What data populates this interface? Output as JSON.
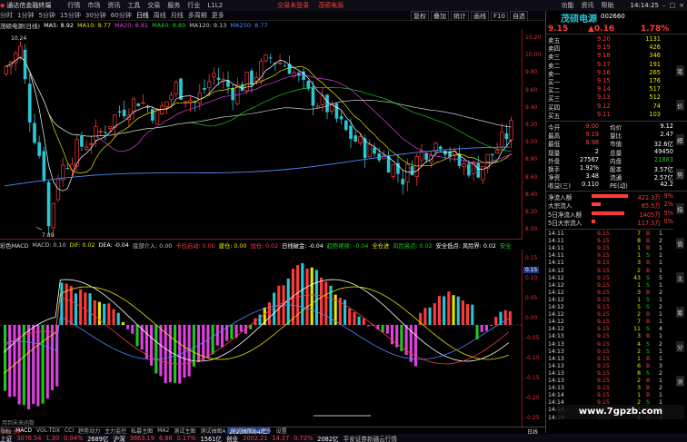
{
  "app": {
    "title": "通达信金融终端",
    "menus": [
      "行情",
      "市场",
      "资讯",
      "工具",
      "交易",
      "服务",
      "行业",
      "L1L2"
    ],
    "trade_login": "交易未登录",
    "stock_name_tab": "茂硕电源",
    "right_menus": [
      "功能",
      "资讯",
      "帮助"
    ],
    "clock": "14:14:25"
  },
  "toolbar": {
    "periods": [
      "分时",
      "1分钟",
      "5分钟",
      "15分钟",
      "30分钟",
      "60分钟",
      "日线",
      "周线",
      "月线",
      "多周期",
      "更多"
    ],
    "tools": [
      "复权",
      "叠加",
      "统计",
      "画线",
      "F10",
      "自选"
    ]
  },
  "chart": {
    "title": "茂硕电源(日线)",
    "ma": [
      {
        "label": "MA5: 8.92",
        "color": "#ffffff"
      },
      {
        "label": "MA10: 8.77",
        "color": "#e6e600"
      },
      {
        "label": "MA20: 8.81",
        "color": "#e13fe1"
      },
      {
        "label": "MA60: 8.89",
        "color": "#1ec81e"
      },
      {
        "label": "MA120: 9.13",
        "color": "#cccccc"
      },
      {
        "label": "MA250: 8.77",
        "color": "#4c8cff"
      }
    ],
    "high_label": "10.24",
    "low_label": "7.89",
    "yticks": [
      "10.20",
      "10.00",
      "9.80",
      "9.60",
      "9.40",
      "9.20",
      "9.00",
      "8.80",
      "8.60",
      "8.40",
      "8.20",
      "8.00"
    ]
  },
  "indicator": {
    "title": "彩色MACD",
    "items": [
      {
        "t": "MACD: 0.10",
        "c": "#c0c0c0"
      },
      {
        "t": "DIF: 0.02",
        "c": "#e6e600"
      },
      {
        "t": "DEA: -0.04",
        "c": "#ffffff"
      },
      {
        "t": "底部介入: 0.00",
        "c": "#c0c0c0"
      },
      {
        "t": "卡位启动: 0.00",
        "c": "#ff3b3b"
      },
      {
        "t": "建仓: 0.00",
        "c": "#e6e600"
      },
      {
        "t": "加仓: 0.02",
        "c": "#ff3b3b"
      },
      {
        "t": "日线破金: -0.04",
        "c": "#ffffff"
      },
      {
        "t": "趋势继续: -0.04",
        "c": "#1ec81e"
      },
      {
        "t": "全仓进",
        "c": "#e6e600"
      },
      {
        "t": "风险高点: 0.02",
        "c": "#1ec81e"
      },
      {
        "t": "安全低点: 风险界: 0.02",
        "c": "#ffffff"
      },
      {
        "t": "安全",
        "c": "#1ec81e"
      }
    ],
    "yticks": [
      "0.15",
      "0.10",
      "0.05",
      "0.00",
      "-0.05",
      "-0.10",
      "-0.15",
      "-0.20",
      "-0.25"
    ],
    "marker": "0.15",
    "note": "用到未来函数"
  },
  "axis": {
    "year": "2023年",
    "cursor_date": "2023/07/04/二",
    "right_label": "日线"
  },
  "bottom_tabs": [
    "指标",
    "MACD",
    "VOL-TDX",
    "CCI",
    "趋势动力",
    "主力监控",
    "私募主图",
    "MA2",
    "测试主图",
    "测试抽图A",
    "测试抽图B",
    "更多",
    "设置"
  ],
  "bottom_tabs2": [
    "扩展↑",
    "关联报价",
    "资金分布",
    "综合资讯",
    "行业资讯",
    "互动问答",
    "普及版功能说明"
  ],
  "quote": {
    "name": "茂硕电源",
    "code": "002660",
    "price": "9.15",
    "change": "▲0.16",
    "pct": "1.78%",
    "asks": [
      {
        "l": "卖五",
        "p": "9.20",
        "v": "1131"
      },
      {
        "l": "卖四",
        "p": "9.19",
        "v": "426"
      },
      {
        "l": "卖三",
        "p": "9.18",
        "v": "346"
      },
      {
        "l": "卖二",
        "p": "9.17",
        "v": "191"
      },
      {
        "l": "卖一",
        "p": "9.16",
        "v": "265"
      }
    ],
    "bids": [
      {
        "l": "买一",
        "p": "9.15",
        "v": "176"
      },
      {
        "l": "买二",
        "p": "9.14",
        "v": "517"
      },
      {
        "l": "买三",
        "p": "9.13",
        "v": "512"
      },
      {
        "l": "买四",
        "p": "9.12",
        "v": "74"
      },
      {
        "l": "买五",
        "p": "9.11",
        "v": "103"
      }
    ],
    "stats": [
      {
        "a": "今开",
        "av": "9.00",
        "b": "均价",
        "bv": "9.12"
      },
      {
        "a": "最高",
        "av": "9.19",
        "b": "量比",
        "bv": "2.47"
      },
      {
        "a": "最低",
        "av": "8.98",
        "b": "市值",
        "bv": "32.6亿"
      },
      {
        "a": "现量",
        "av": "2",
        "b": "总量",
        "bv": "49450"
      },
      {
        "a": "外盘",
        "av": "27567",
        "b": "内盘",
        "bv": "21883"
      },
      {
        "a": "换手",
        "av": "1.92%",
        "b": "股本",
        "bv": "3.57亿"
      },
      {
        "a": "净资",
        "av": "3.48",
        "b": "流通",
        "bv": "2.57亿"
      },
      {
        "a": "收益(三)",
        "av": "0.110",
        "b": "PE(动)",
        "bv": "42.2"
      }
    ],
    "flows": [
      {
        "l": "净流入额",
        "v": "421.3万",
        "p": "9%"
      },
      {
        "l": "大宗流入",
        "v": "85.5万",
        "p": "2%"
      },
      {
        "l": "5日净流入额",
        "v": "1405万",
        "p": "5%"
      },
      {
        "l": "5日大宗流入",
        "v": "117.3万",
        "p": "0%"
      }
    ],
    "ticks": [
      {
        "t": "14:11",
        "p": "9.15",
        "v": "7",
        "d": "B",
        "n": "1"
      },
      {
        "t": "14:11",
        "p": "9.15",
        "v": "8",
        "d": "B",
        "n": "2"
      },
      {
        "t": "14:11",
        "p": "9.15",
        "v": "1",
        "d": "B",
        "n": "1"
      },
      {
        "t": "14:11",
        "p": "9.15",
        "v": "1",
        "d": "S",
        "n": "1"
      },
      {
        "t": "14:11",
        "p": "9.15",
        "v": "3",
        "d": "B",
        "n": "1"
      },
      {
        "t": "14:12",
        "p": "9.15",
        "v": "2",
        "d": "B",
        "n": "1"
      },
      {
        "t": "14:12",
        "p": "9.15",
        "v": "43",
        "d": "S",
        "n": "5"
      },
      {
        "t": "14:12",
        "p": "9.15",
        "v": "1",
        "d": "S",
        "n": "1"
      },
      {
        "t": "14:12",
        "p": "9.15",
        "v": "3",
        "d": "B",
        "n": "2"
      },
      {
        "t": "14:12",
        "p": "9.15",
        "v": "1",
        "d": "S",
        "n": "1"
      },
      {
        "t": "14:12",
        "p": "9.15",
        "v": "5",
        "d": "S",
        "n": "2"
      },
      {
        "t": "14:12",
        "p": "9.15",
        "v": "2",
        "d": "B",
        "n": "1"
      },
      {
        "t": "14:12",
        "p": "9.15",
        "v": "7",
        "d": "B",
        "n": "1"
      },
      {
        "t": "14:12",
        "p": "9.15",
        "v": "11",
        "d": "S",
        "n": "4"
      },
      {
        "t": "14:13",
        "p": "9.15",
        "v": "3",
        "d": "B",
        "n": "1"
      },
      {
        "t": "14:13",
        "p": "9.15",
        "v": "4",
        "d": "S",
        "n": "2"
      },
      {
        "t": "14:13",
        "p": "9.15",
        "v": "2",
        "d": "S",
        "n": "1"
      },
      {
        "t": "14:13",
        "p": "9.15",
        "v": "1",
        "d": "B",
        "n": "1"
      },
      {
        "t": "14:13",
        "p": "9.15",
        "v": "6",
        "d": "B",
        "n": "3"
      },
      {
        "t": "14:13",
        "p": "9.15",
        "v": "8",
        "d": "S",
        "n": "2"
      },
      {
        "t": "14:13",
        "p": "9.15",
        "v": "2",
        "d": "B",
        "n": "1"
      },
      {
        "t": "14:13",
        "p": "9.15",
        "v": "3",
        "d": "B",
        "n": "2"
      },
      {
        "t": "14:14",
        "p": "9.15",
        "v": "1",
        "d": "B",
        "n": "1"
      },
      {
        "t": "14:14",
        "p": "9.15",
        "v": "2",
        "d": "S",
        "n": "1"
      },
      {
        "t": "14:14",
        "p": "9.15",
        "v": "4",
        "d": "B",
        "n": "2"
      },
      {
        "t": "14:14",
        "p": "9.15",
        "v": "2",
        "d": "B",
        "n": "1"
      }
    ],
    "right_tabs": [
      "笔",
      "价",
      "细",
      "势",
      "指",
      "值",
      "主",
      "筹",
      "分",
      "测"
    ]
  },
  "status": {
    "items": [
      {
        "t": "上证",
        "c": "#ffffff"
      },
      {
        "t": "3076.54",
        "c": "#ff3b3b"
      },
      {
        "t": "1.30",
        "c": "#ff3b3b"
      },
      {
        "t": "0.04%",
        "c": "#ff3b3b"
      },
      {
        "t": "2689亿",
        "c": "#ffffff"
      },
      {
        "t": "沪深",
        "c": "#ffffff"
      },
      {
        "t": "3663.19",
        "c": "#ff3b3b"
      },
      {
        "t": "6.86",
        "c": "#ff3b3b"
      },
      {
        "t": "0.17%",
        "c": "#ff3b3b"
      },
      {
        "t": "1561亿",
        "c": "#ffffff"
      },
      {
        "t": "创业",
        "c": "#ffffff"
      },
      {
        "t": "2002.21",
        "c": "#ff3b3b"
      },
      {
        "t": "14.27",
        "c": "#ff3b3b"
      },
      {
        "t": "0.72%",
        "c": "#ff3b3b"
      },
      {
        "t": "2082亿",
        "c": "#ffffff"
      },
      {
        "t": "平安证券新疆云行情",
        "c": "#c0c0c0"
      }
    ]
  },
  "watermark": "www.7gpzb.com"
}
